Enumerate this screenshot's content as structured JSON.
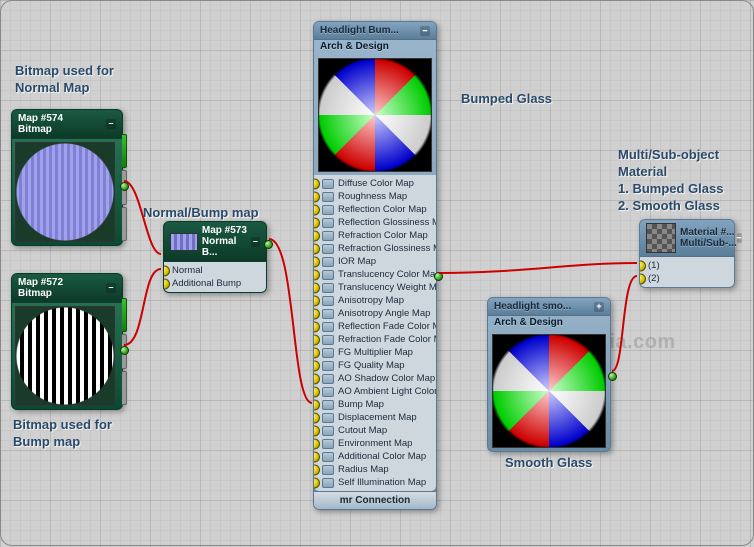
{
  "annotations": {
    "normalmap_bitmap": "Bitmap used for\nNormal Map",
    "bumpmap_bitmap": "Bitmap used for\nBump map",
    "normal_bump_map": "Normal/Bump map",
    "bumped_glass": "Bumped Glass",
    "smooth_glass": "Smooth Glass",
    "multi": "Multi/Sub-object\nMaterial\n1. Bumped Glass\n2. Smooth Glass"
  },
  "watermark": "dhmultimedia.com",
  "nodes": {
    "map574": {
      "title": "Map #574",
      "sub": "Bitmap"
    },
    "map572": {
      "title": "Map #572",
      "sub": "Bitmap"
    },
    "map573": {
      "title": "Map #573",
      "sub": "Normal B..."
    },
    "map573_slots": [
      "Normal",
      "Additional Bump"
    ],
    "headlight_bumped": {
      "title": "Headlight Bum...",
      "sub": "Arch & Design"
    },
    "headlight_smooth": {
      "title": "Headlight smo...",
      "sub": "Arch & Design"
    },
    "material_multi": {
      "title": "Material #...",
      "sub": "Multi/Sub-..."
    },
    "material_slots": [
      "(1)",
      "(2)"
    ]
  },
  "arch_slots": [
    "Diffuse Color Map",
    "Roughness Map",
    "Reflection Color Map",
    "Reflection Glossiness Map",
    "Refraction Color Map",
    "Refraction Glossiness Map",
    "IOR Map",
    "Translucency Color Map",
    "Translucency Weight Map",
    "Anisotropy Map",
    "Anisotropy Angle Map",
    "Reflection Fade Color Map",
    "Refraction Fade Color Map",
    "FG Multiplier Map",
    "FG Quality Map",
    "AO Shadow Color Map",
    "AO Ambient Light Color...",
    "Bump Map",
    "Displacement Map",
    "Cutout Map",
    "Environment Map",
    "Additional Color Map",
    "Radius Map",
    "Self Illumination Map"
  ],
  "mr_connection": "mr Connection",
  "icons": {
    "minimize": "–",
    "expand": "+"
  }
}
